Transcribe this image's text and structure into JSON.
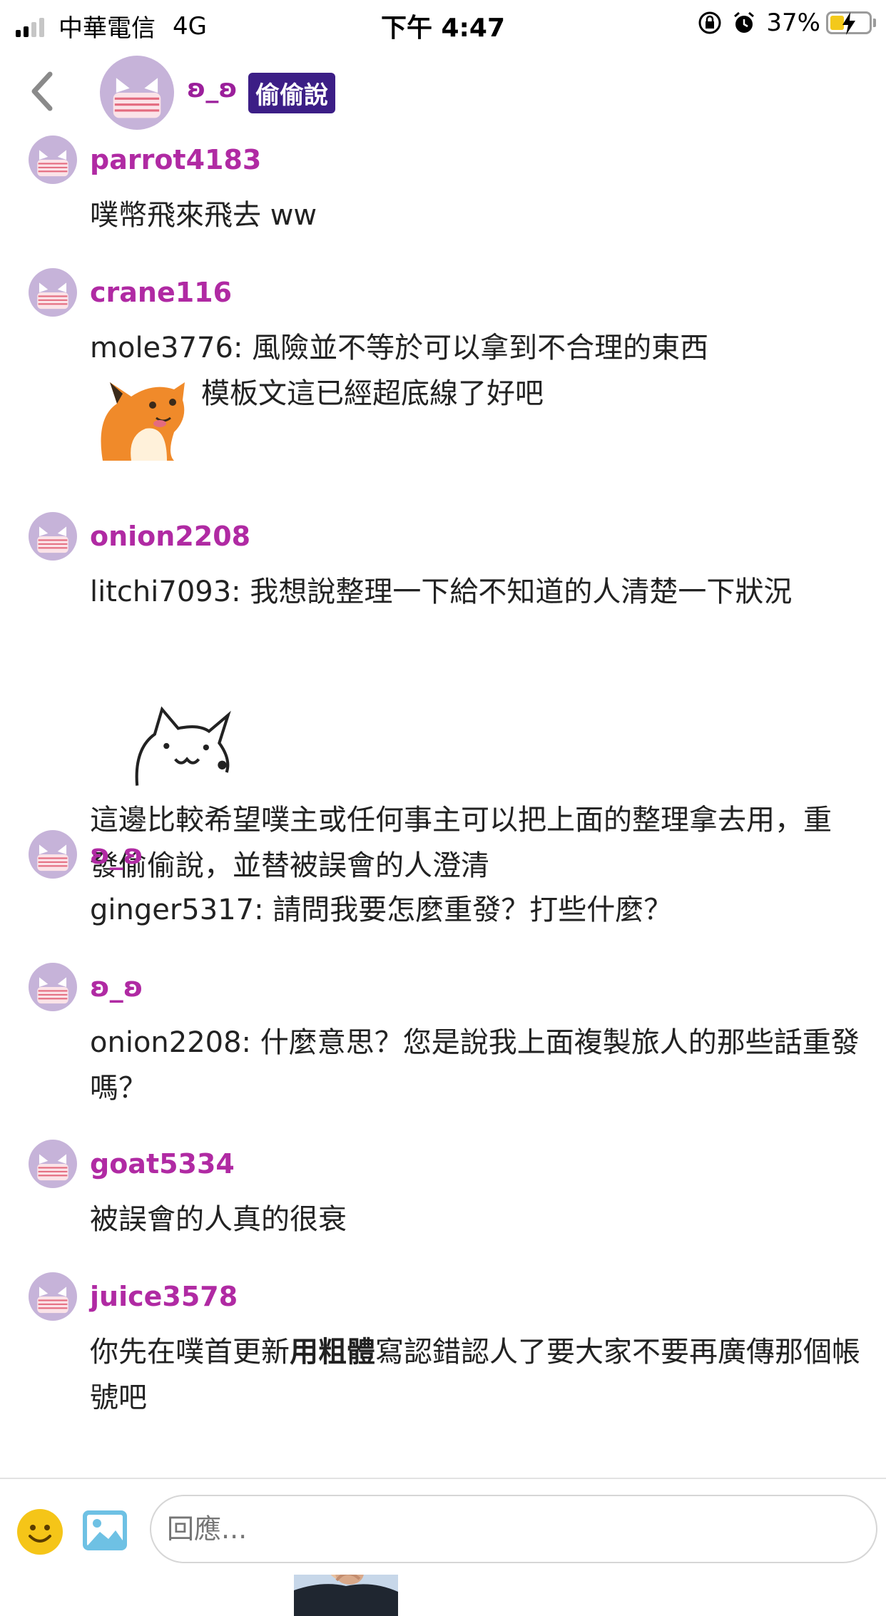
{
  "status_bar": {
    "carrier": "中華電信",
    "network": "4G",
    "time": "下午 4:47",
    "battery_percent": "37%"
  },
  "header": {
    "username": "ʚ_ʚ",
    "badge": "偷偷說"
  },
  "comments": [
    {
      "user": "parrot4183",
      "lines": [
        "噗幣飛來飛去 ww"
      ]
    },
    {
      "user": "crane116",
      "lines": [
        "mole3776: 風險並不等於可以拿到不合理的東西",
        "模板文這已經超底線了好吧"
      ]
    },
    {
      "user": "onion2208",
      "lines": [
        "litchi7093: 我想說整理一下給不知道的人清楚一下狀況",
        "這邊比較希望噗主或任何事主可以把上面的整理拿去用，重發偷偷說，並替被誤會的人澄清"
      ]
    },
    {
      "user": "ʚ_ʚ",
      "lines": [
        "ginger5317: 請問我要怎麼重發？打些什麼？"
      ]
    },
    {
      "user": "ʚ_ʚ",
      "lines": [
        "onion2208: 什麼意思？您是說我上面複製旅人的那些話重發嗎？"
      ]
    },
    {
      "user": "goat5334",
      "lines": [
        "被誤會的人真的很衰"
      ]
    },
    {
      "user": "juice3578",
      "text_before_bold": "你先在噗首更新",
      "bold": "用粗體",
      "text_after_bold": "寫認錯認人了要大家不要再廣傳那個帳號吧"
    }
  ],
  "reply_input": {
    "placeholder": "回應..."
  },
  "colors": {
    "username": "#b02aa3",
    "badge_bg": "#3c1e86",
    "avatar_bg": "#c6b3d9",
    "battery": "#f3c91b"
  }
}
